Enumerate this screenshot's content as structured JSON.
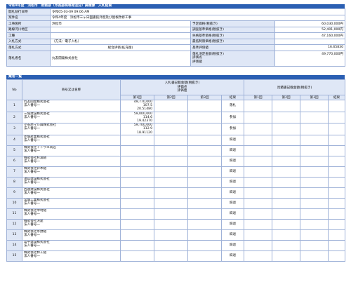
{
  "result_title": "令和4年度　浜松市　財務部（市長部局等発注分）調達課　入札結果",
  "info_rows": [
    {
      "l1": "開札執行日時",
      "v1": "令和05-03-09 09:06 AM",
      "l2": "",
      "v2": ""
    },
    {
      "l1": "案件名",
      "v1": "令和4年度　浜松市三ヶ日図書館外壁及び屋根改修工事",
      "l2": "",
      "v2": ""
    },
    {
      "l1": "工事箇所",
      "v1": "浜松市",
      "l2": "予定価格(税抜き)",
      "v2": "60,030,000円"
    },
    {
      "l1": "路線河川地区",
      "v1": "",
      "l2": "調査基準価格(税抜き)",
      "v2": "52,401,000円"
    },
    {
      "l1": "工種",
      "v1": "",
      "l2": "失格基準価格(税抜き)",
      "v2": "47,160,000円"
    },
    {
      "l1": "入札方式",
      "v1": "（方法：電子入札）",
      "l2": "最低制限価格(税抜き)",
      "v2": ""
    },
    {
      "l1": "落札方式",
      "v1": "総合評価(拡充版)",
      "l2": "基準評価値",
      "v2": "16.65830"
    }
  ],
  "winner": {
    "label": "落札者名",
    "value": "丸友開発株式会社",
    "labels": [
      "落札決定金額(税抜き)",
      "評価点",
      "評価値"
    ],
    "amount": "49,770,000円"
  },
  "list_title": "業者一覧",
  "headers": {
    "no": "No",
    "name": "商号又は名称",
    "bid_group": "入札書記載金額(税抜き)",
    "bid_sub1": "評価点",
    "bid_sub2": "評価値",
    "ref_group": "見積書記載金額(税抜き)",
    "round1": "第1回",
    "round2": "第2回",
    "round3": "第3回",
    "result": "結果"
  },
  "bidders": [
    {
      "no": "1",
      "name": "丸友開発株式会社",
      "rep": "法人番号一",
      "amount": "49,770,000",
      "score": "107.5",
      "value": "20.51480",
      "result": "落札"
    },
    {
      "no": "2",
      "name": "三協建設株式会社",
      "rep": "法人番号一",
      "amount": "59,000,000",
      "score": "114.6",
      "value": "19.42370",
      "result": "参加"
    },
    {
      "no": "3",
      "name": "小笠原マル興株式会社",
      "rep": "法人番号一",
      "amount": "59,700,000",
      "score": "112.9",
      "value": "18.91120",
      "result": "参加"
    },
    {
      "no": "4",
      "name": "赤堀産業株式会社",
      "rep": "法人番号一",
      "amount": "",
      "score": "",
      "value": "",
      "result": "辞退"
    },
    {
      "no": "5",
      "name": "株式会社イトウエ商店",
      "rep": "法人番号一",
      "amount": "",
      "score": "",
      "value": "",
      "result": "辞退"
    },
    {
      "no": "6",
      "name": "株式会社杉浦組",
      "rep": "法人番号一",
      "amount": "",
      "score": "",
      "value": "",
      "result": "辞退"
    },
    {
      "no": "7",
      "name": "株式会社鈴木組",
      "rep": "法人番号一",
      "amount": "",
      "score": "",
      "value": "",
      "result": "辞退"
    },
    {
      "no": "8",
      "name": "須山建設株式会社",
      "rep": "法人番号一",
      "amount": "",
      "score": "",
      "value": "",
      "result": "辞退"
    },
    {
      "no": "9",
      "name": "西遠建設株式会社",
      "rep": "法人番号一",
      "amount": "",
      "score": "",
      "value": "",
      "result": "辞退"
    },
    {
      "no": "10",
      "name": "常盤工業株式会社",
      "rep": "法人番号一",
      "amount": "",
      "score": "",
      "value": "",
      "result": "辞退"
    },
    {
      "no": "11",
      "name": "株式会社中村組",
      "rep": "法人番号一",
      "amount": "",
      "score": "",
      "value": "",
      "result": "辞退"
    },
    {
      "no": "12",
      "name": "株式会社浜建",
      "rep": "法人番号一",
      "amount": "",
      "score": "",
      "value": "",
      "result": "辞退"
    },
    {
      "no": "13",
      "name": "株式会社水野組",
      "rep": "法人番号一",
      "amount": "",
      "score": "",
      "value": "",
      "result": "辞退"
    },
    {
      "no": "14",
      "name": "山平建設株式会社",
      "rep": "法人番号一",
      "amount": "",
      "score": "",
      "value": "",
      "result": "辞退"
    },
    {
      "no": "15",
      "name": "株式会社林工組",
      "rep": "法人番号一",
      "amount": "",
      "score": "",
      "value": "",
      "result": "辞退"
    }
  ]
}
